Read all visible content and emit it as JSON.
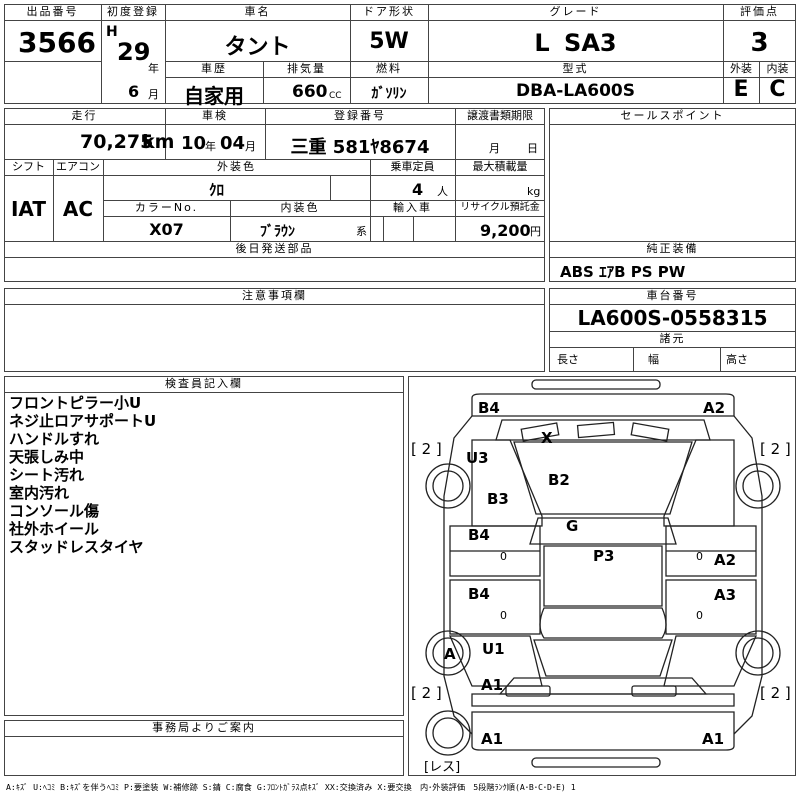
{
  "header": {
    "lot_no_label": "出品番号",
    "lot_no": "3566",
    "first_reg_label": "初度登録",
    "era": "H",
    "first_reg_year": "29",
    "year_unit": "年",
    "first_reg_month": "6",
    "month_unit": "月",
    "car_name_label": "車名",
    "car_name": "タント",
    "door_label": "ドア形状",
    "door": "5W",
    "grade_label": "グレード",
    "grade": "L SA3",
    "score_label": "評価点",
    "score": "3",
    "history_label": "車歴",
    "history": "自家用",
    "displacement_label": "排気量",
    "displacement": "660",
    "displacement_unit": "CC",
    "fuel_label": "燃料",
    "fuel": "ｶﾞｿﾘﾝ",
    "model_label": "型式",
    "model": "DBA-LA600S",
    "exterior_label": "外装",
    "exterior": "E",
    "interior_label": "内装",
    "interior": "C"
  },
  "row2": {
    "mileage_label": "走行",
    "mileage": "70,275",
    "mileage_unit": "km",
    "inspection_label": "車検",
    "inspection_year": "10",
    "inspection_year_unit": "年",
    "inspection_month": "04",
    "inspection_month_unit": "月",
    "plate_label": "登録番号",
    "plate": "三重 581ﾔ8674",
    "transfer_label": "譲渡書類期限",
    "transfer_month_unit": "月",
    "transfer_day_unit": "日",
    "sales_points_label": "セールスポイント"
  },
  "row3": {
    "shift_label": "シフト",
    "shift": "IAT",
    "ac_label": "エアコン",
    "ac": "AC",
    "ext_color_label": "外装色",
    "ext_color": "ｸﾛ",
    "capacity_label": "乗車定員",
    "capacity": "4",
    "capacity_unit": "人",
    "max_load_label": "最大積載量",
    "max_load_unit": "kg",
    "color_no_label": "カラーNo.",
    "color_no": "X07",
    "int_color_label": "内装色",
    "int_color": "ﾌﾞﾗｳﾝ",
    "int_color_suffix": "系",
    "import_label": "輸入車",
    "recycle_label": "リサイクル預託金",
    "recycle": "9,200",
    "recycle_unit": "円"
  },
  "later_parts_label": "後日発送部品",
  "equipment_label": "純正装備",
  "equipment": "ABS ｴｱB PS PW",
  "notes_label": "注意事項欄",
  "chassis_label": "車台番号",
  "chassis": "LA600S-0558315",
  "specs_label": "諸元",
  "length_label": "長さ",
  "width_label": "幅",
  "height_label": "高さ",
  "inspector_label": "検査員記入欄",
  "inspector_notes": [
    "フロントピラー小U",
    "ネジ止ロアサポートU",
    "ハンドルすれ",
    "天張しみ中",
    "シート汚れ",
    "室内汚れ",
    "コンソール傷",
    "社外ホイール",
    "スタッドレスタイヤ"
  ],
  "office_label": "事務局よりご案内",
  "diagram": {
    "tread_fl": "[ 2 ]",
    "tread_fr": "[ 2 ]",
    "tread_rl": "[ 2 ]",
    "tread_rr": "[ 2 ]",
    "spare": "[レス]",
    "marks": {
      "front_bumper_left": "B4",
      "front_bumper_right": "A2",
      "windshield": "X",
      "pillar_left": "U3",
      "hood": "B2",
      "fender_left": "B3",
      "roof": "G",
      "front_door_left": "B4",
      "front_door_left_num": "0",
      "front_door_right": "A2",
      "front_door_right_num": "0",
      "cabin": "P3",
      "rear_door_left": "B4",
      "rear_door_left_num": "0",
      "rear_door_right": "A3",
      "rear_door_right_num": "0",
      "rear_wheel_left": "A",
      "rear_pillar_left": "U1",
      "rear_quarter_left": "A1",
      "rear_bumper_left": "A1",
      "rear_bumper_right": "A1"
    }
  },
  "footer_legend": "A:ｷｽﾞ U:ﾍｺﾐ B:ｷｽﾞを伴うﾍｺﾐ P:要塗装 W:補修跡 S:錆 C:腐食 G:ﾌﾛﾝﾄｶﾞﾗｽ点ｷｽﾞ XX:交換済み X:要交換　内･外装評価　5段階ﾗﾝｸ順(A･B･C･D･E) 1"
}
